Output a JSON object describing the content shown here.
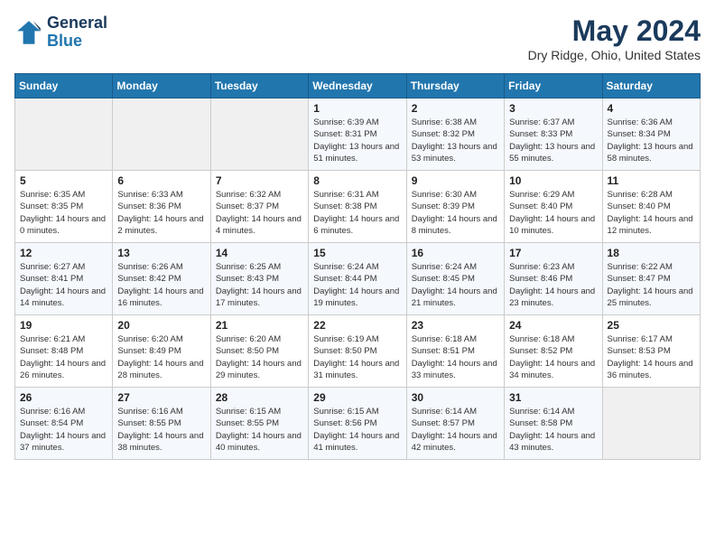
{
  "header": {
    "logo_line1": "General",
    "logo_line2": "Blue",
    "month_title": "May 2024",
    "location": "Dry Ridge, Ohio, United States"
  },
  "weekdays": [
    "Sunday",
    "Monday",
    "Tuesday",
    "Wednesday",
    "Thursday",
    "Friday",
    "Saturday"
  ],
  "weeks": [
    [
      {
        "day": "",
        "sunrise": "",
        "sunset": "",
        "daylight": ""
      },
      {
        "day": "",
        "sunrise": "",
        "sunset": "",
        "daylight": ""
      },
      {
        "day": "",
        "sunrise": "",
        "sunset": "",
        "daylight": ""
      },
      {
        "day": "1",
        "sunrise": "Sunrise: 6:39 AM",
        "sunset": "Sunset: 8:31 PM",
        "daylight": "Daylight: 13 hours and 51 minutes."
      },
      {
        "day": "2",
        "sunrise": "Sunrise: 6:38 AM",
        "sunset": "Sunset: 8:32 PM",
        "daylight": "Daylight: 13 hours and 53 minutes."
      },
      {
        "day": "3",
        "sunrise": "Sunrise: 6:37 AM",
        "sunset": "Sunset: 8:33 PM",
        "daylight": "Daylight: 13 hours and 55 minutes."
      },
      {
        "day": "4",
        "sunrise": "Sunrise: 6:36 AM",
        "sunset": "Sunset: 8:34 PM",
        "daylight": "Daylight: 13 hours and 58 minutes."
      }
    ],
    [
      {
        "day": "5",
        "sunrise": "Sunrise: 6:35 AM",
        "sunset": "Sunset: 8:35 PM",
        "daylight": "Daylight: 14 hours and 0 minutes."
      },
      {
        "day": "6",
        "sunrise": "Sunrise: 6:33 AM",
        "sunset": "Sunset: 8:36 PM",
        "daylight": "Daylight: 14 hours and 2 minutes."
      },
      {
        "day": "7",
        "sunrise": "Sunrise: 6:32 AM",
        "sunset": "Sunset: 8:37 PM",
        "daylight": "Daylight: 14 hours and 4 minutes."
      },
      {
        "day": "8",
        "sunrise": "Sunrise: 6:31 AM",
        "sunset": "Sunset: 8:38 PM",
        "daylight": "Daylight: 14 hours and 6 minutes."
      },
      {
        "day": "9",
        "sunrise": "Sunrise: 6:30 AM",
        "sunset": "Sunset: 8:39 PM",
        "daylight": "Daylight: 14 hours and 8 minutes."
      },
      {
        "day": "10",
        "sunrise": "Sunrise: 6:29 AM",
        "sunset": "Sunset: 8:40 PM",
        "daylight": "Daylight: 14 hours and 10 minutes."
      },
      {
        "day": "11",
        "sunrise": "Sunrise: 6:28 AM",
        "sunset": "Sunset: 8:40 PM",
        "daylight": "Daylight: 14 hours and 12 minutes."
      }
    ],
    [
      {
        "day": "12",
        "sunrise": "Sunrise: 6:27 AM",
        "sunset": "Sunset: 8:41 PM",
        "daylight": "Daylight: 14 hours and 14 minutes."
      },
      {
        "day": "13",
        "sunrise": "Sunrise: 6:26 AM",
        "sunset": "Sunset: 8:42 PM",
        "daylight": "Daylight: 14 hours and 16 minutes."
      },
      {
        "day": "14",
        "sunrise": "Sunrise: 6:25 AM",
        "sunset": "Sunset: 8:43 PM",
        "daylight": "Daylight: 14 hours and 17 minutes."
      },
      {
        "day": "15",
        "sunrise": "Sunrise: 6:24 AM",
        "sunset": "Sunset: 8:44 PM",
        "daylight": "Daylight: 14 hours and 19 minutes."
      },
      {
        "day": "16",
        "sunrise": "Sunrise: 6:24 AM",
        "sunset": "Sunset: 8:45 PM",
        "daylight": "Daylight: 14 hours and 21 minutes."
      },
      {
        "day": "17",
        "sunrise": "Sunrise: 6:23 AM",
        "sunset": "Sunset: 8:46 PM",
        "daylight": "Daylight: 14 hours and 23 minutes."
      },
      {
        "day": "18",
        "sunrise": "Sunrise: 6:22 AM",
        "sunset": "Sunset: 8:47 PM",
        "daylight": "Daylight: 14 hours and 25 minutes."
      }
    ],
    [
      {
        "day": "19",
        "sunrise": "Sunrise: 6:21 AM",
        "sunset": "Sunset: 8:48 PM",
        "daylight": "Daylight: 14 hours and 26 minutes."
      },
      {
        "day": "20",
        "sunrise": "Sunrise: 6:20 AM",
        "sunset": "Sunset: 8:49 PM",
        "daylight": "Daylight: 14 hours and 28 minutes."
      },
      {
        "day": "21",
        "sunrise": "Sunrise: 6:20 AM",
        "sunset": "Sunset: 8:50 PM",
        "daylight": "Daylight: 14 hours and 29 minutes."
      },
      {
        "day": "22",
        "sunrise": "Sunrise: 6:19 AM",
        "sunset": "Sunset: 8:50 PM",
        "daylight": "Daylight: 14 hours and 31 minutes."
      },
      {
        "day": "23",
        "sunrise": "Sunrise: 6:18 AM",
        "sunset": "Sunset: 8:51 PM",
        "daylight": "Daylight: 14 hours and 33 minutes."
      },
      {
        "day": "24",
        "sunrise": "Sunrise: 6:18 AM",
        "sunset": "Sunset: 8:52 PM",
        "daylight": "Daylight: 14 hours and 34 minutes."
      },
      {
        "day": "25",
        "sunrise": "Sunrise: 6:17 AM",
        "sunset": "Sunset: 8:53 PM",
        "daylight": "Daylight: 14 hours and 36 minutes."
      }
    ],
    [
      {
        "day": "26",
        "sunrise": "Sunrise: 6:16 AM",
        "sunset": "Sunset: 8:54 PM",
        "daylight": "Daylight: 14 hours and 37 minutes."
      },
      {
        "day": "27",
        "sunrise": "Sunrise: 6:16 AM",
        "sunset": "Sunset: 8:55 PM",
        "daylight": "Daylight: 14 hours and 38 minutes."
      },
      {
        "day": "28",
        "sunrise": "Sunrise: 6:15 AM",
        "sunset": "Sunset: 8:55 PM",
        "daylight": "Daylight: 14 hours and 40 minutes."
      },
      {
        "day": "29",
        "sunrise": "Sunrise: 6:15 AM",
        "sunset": "Sunset: 8:56 PM",
        "daylight": "Daylight: 14 hours and 41 minutes."
      },
      {
        "day": "30",
        "sunrise": "Sunrise: 6:14 AM",
        "sunset": "Sunset: 8:57 PM",
        "daylight": "Daylight: 14 hours and 42 minutes."
      },
      {
        "day": "31",
        "sunrise": "Sunrise: 6:14 AM",
        "sunset": "Sunset: 8:58 PM",
        "daylight": "Daylight: 14 hours and 43 minutes."
      },
      {
        "day": "",
        "sunrise": "",
        "sunset": "",
        "daylight": ""
      }
    ]
  ]
}
